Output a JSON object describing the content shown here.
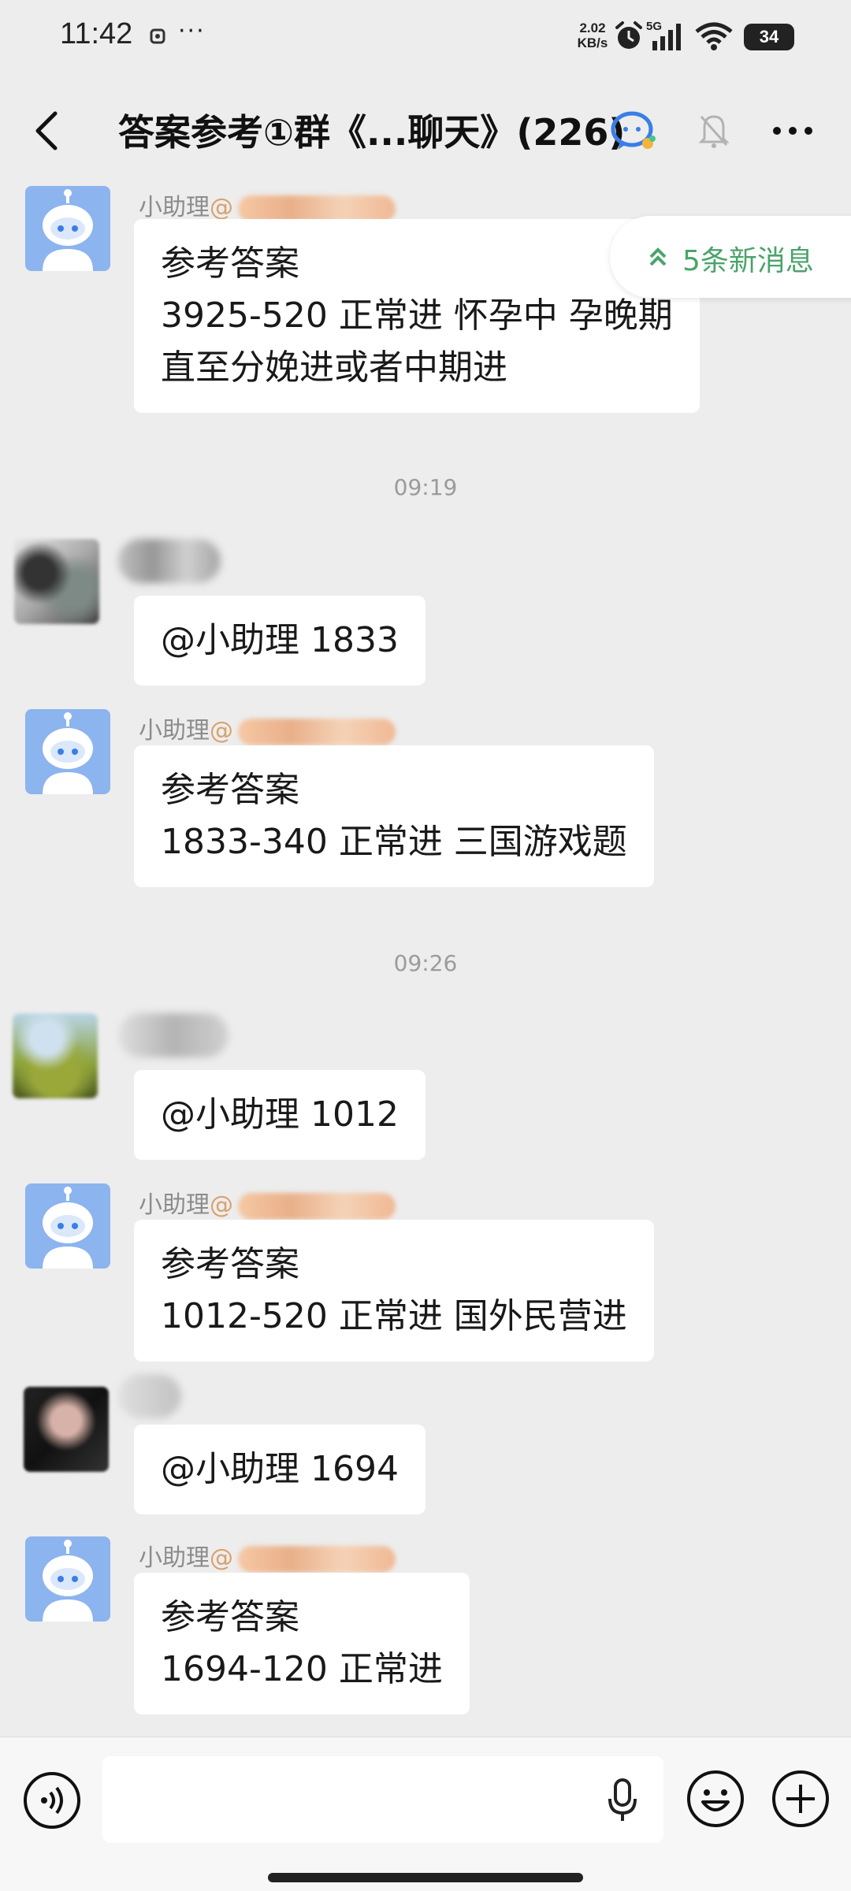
{
  "status_bar": {
    "time": "11:42",
    "more": "···",
    "net_speed_value": "2.02",
    "net_speed_unit": "KB/s",
    "network": "5G",
    "battery": "34"
  },
  "nav": {
    "title": "答案参考①群《...聊天》(226)",
    "icons": [
      "back-arrow-icon",
      "chat-bot-icon",
      "mute-bell-icon",
      "more-icon"
    ]
  },
  "new_messages": {
    "label": "5条新消息"
  },
  "messages": [
    {
      "sender_name": "小助理",
      "sender_at": "@",
      "lines": [
        "参考答案",
        "3925-520 正常进 怀孕中 孕晚期",
        "直至分娩进或者中期进"
      ]
    },
    {
      "timestamp": "09:19"
    },
    {
      "lines": [
        "@小助理 1833"
      ]
    },
    {
      "sender_name": "小助理",
      "sender_at": "@",
      "lines": [
        "参考答案",
        "1833-340 正常进 三国游戏题"
      ]
    },
    {
      "timestamp": "09:26"
    },
    {
      "lines": [
        "@小助理 1012"
      ]
    },
    {
      "sender_name": "小助理",
      "sender_at": "@",
      "lines": [
        "参考答案",
        "1012-520 正常进 国外民营进"
      ]
    },
    {
      "lines": [
        "@小助理 1694"
      ]
    },
    {
      "sender_name": "小助理",
      "sender_at": "@",
      "lines": [
        "参考答案",
        "1694-120 正常进"
      ]
    }
  ],
  "input_bar": {
    "icons": [
      "voice-icon",
      "mic-icon",
      "emoji-icon",
      "plus-icon"
    ]
  },
  "colors": {
    "background": "#ededed",
    "bubble": "#ffffff",
    "accent_green": "#4aa46b",
    "sender_gray": "#8c8c8c",
    "bot_avatar": "#8cb4ee"
  }
}
